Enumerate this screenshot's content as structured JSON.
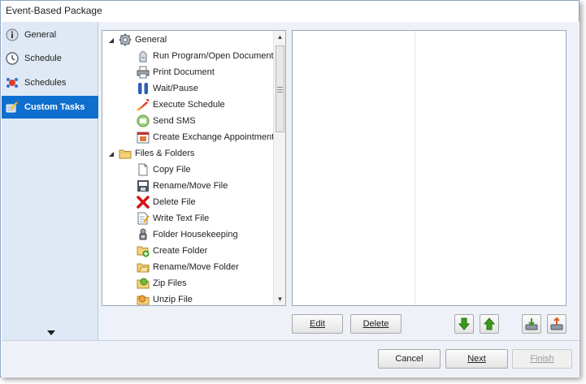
{
  "window": {
    "title": "Event-Based Package"
  },
  "nav": {
    "items": [
      {
        "label": "General",
        "icon": "info-icon"
      },
      {
        "label": "Schedule",
        "icon": "clock-icon"
      },
      {
        "label": "Schedules",
        "icon": "schedules-icon"
      },
      {
        "label": "Custom Tasks",
        "icon": "custom-tasks-icon",
        "active": true
      }
    ]
  },
  "tree": {
    "groups": [
      {
        "label": "General",
        "icon": "gear-icon",
        "items": [
          {
            "label": "Run Program/Open Document",
            "icon": "run-program-icon"
          },
          {
            "label": "Print Document",
            "icon": "printer-icon"
          },
          {
            "label": "Wait/Pause",
            "icon": "pause-icon"
          },
          {
            "label": "Execute Schedule",
            "icon": "execute-schedule-icon"
          },
          {
            "label": "Send SMS",
            "icon": "sms-icon"
          },
          {
            "label": "Create Exchange Appointment",
            "icon": "exchange-appointment-icon"
          }
        ]
      },
      {
        "label": "Files & Folders",
        "icon": "folder-icon",
        "items": [
          {
            "label": "Copy File",
            "icon": "copy-file-icon"
          },
          {
            "label": "Rename/Move File",
            "icon": "rename-file-icon"
          },
          {
            "label": "Delete File",
            "icon": "delete-icon"
          },
          {
            "label": "Write Text File",
            "icon": "write-text-icon"
          },
          {
            "label": "Folder Housekeeping",
            "icon": "housekeeping-icon"
          },
          {
            "label": "Create Folder",
            "icon": "create-folder-icon"
          },
          {
            "label": "Rename/Move Folder",
            "icon": "rename-folder-icon"
          },
          {
            "label": "Zip Files",
            "icon": "zip-icon"
          },
          {
            "label": "Unzip File",
            "icon": "unzip-icon"
          }
        ]
      }
    ]
  },
  "actions": {
    "edit_label": "Edit",
    "delete_label": "Delete"
  },
  "footer": {
    "cancel_label": "Cancel",
    "next_label": "Next",
    "finish_label": "Finish"
  },
  "colors": {
    "accent": "#0f6fce",
    "nav_bg": "#dfe9f5",
    "content_bg": "#eef2f8",
    "move_arrow_green": "#3a9a1c",
    "delete_red": "#d4161c"
  }
}
